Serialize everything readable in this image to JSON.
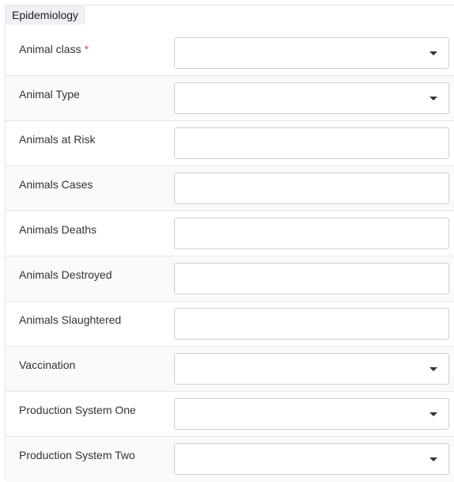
{
  "section": {
    "title": "Epidemiology"
  },
  "fields": {
    "animal_class": {
      "label": "Animal class",
      "required_mark": "*",
      "value": ""
    },
    "animal_type": {
      "label": "Animal Type",
      "value": ""
    },
    "animals_at_risk": {
      "label": "Animals at Risk",
      "value": ""
    },
    "animals_cases": {
      "label": "Animals Cases",
      "value": ""
    },
    "animals_deaths": {
      "label": "Animals Deaths",
      "value": ""
    },
    "animals_destroyed": {
      "label": "Animals Destroyed",
      "value": ""
    },
    "animals_slaughtered": {
      "label": "Animals Slaughtered",
      "value": ""
    },
    "vaccination": {
      "label": "Vaccination",
      "value": ""
    },
    "production_system_one": {
      "label": "Production System One",
      "value": ""
    },
    "production_system_two": {
      "label": "Production System Two",
      "value": ""
    }
  },
  "icons": {
    "dropdown": "chevron-down-icon"
  }
}
